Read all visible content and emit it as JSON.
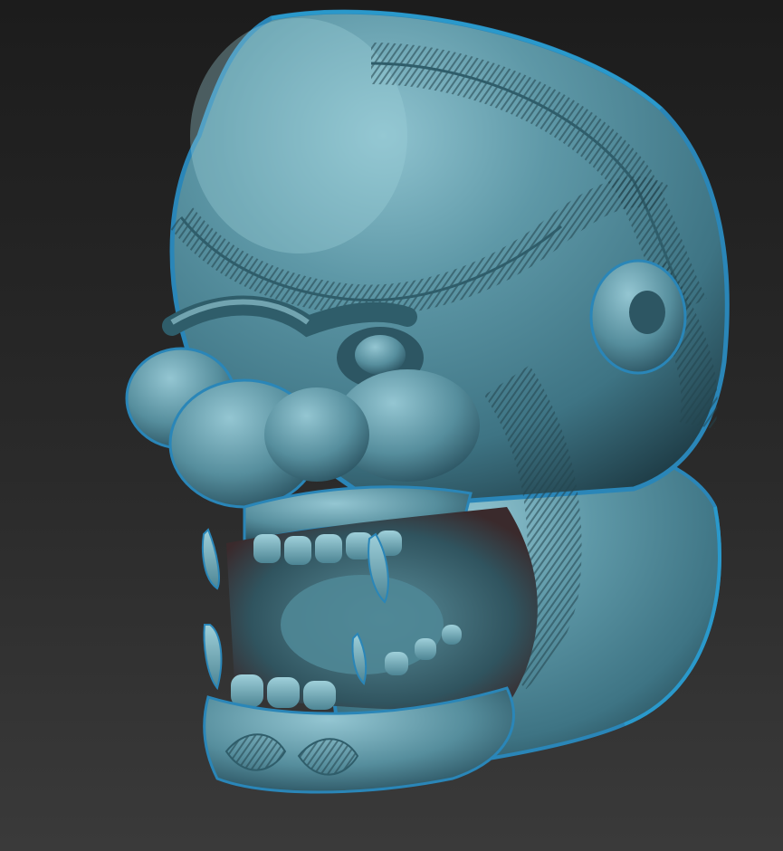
{
  "viewport": {
    "subject": "demon-head-sculpt",
    "background_colors": [
      "#1c1c1c",
      "#3a3a3a"
    ],
    "material_colors": {
      "base": "#4f8796",
      "highlight": "#8fc3cf",
      "shadow": "#1f3d47",
      "rim": "#2a86b8",
      "cavity": "#3a2a2c"
    }
  }
}
